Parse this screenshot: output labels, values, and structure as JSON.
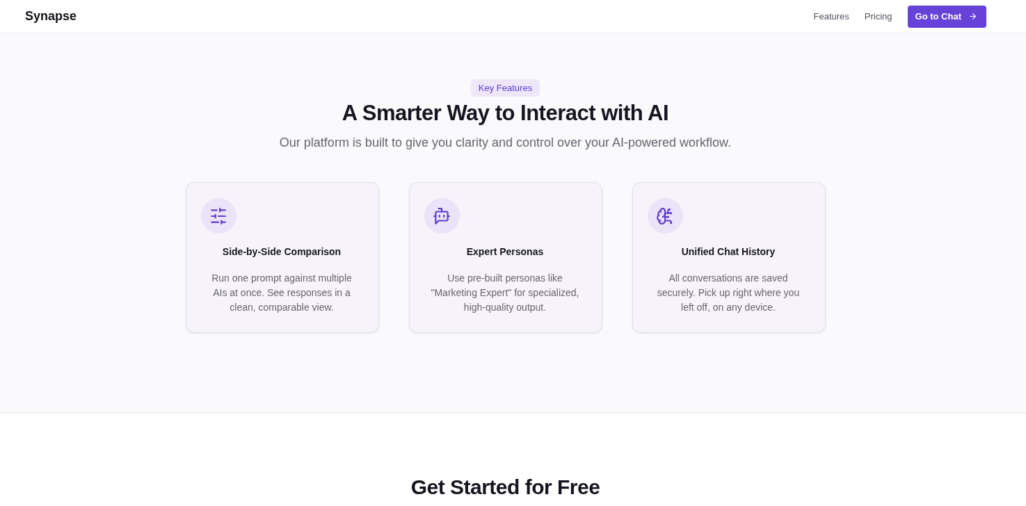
{
  "header": {
    "logo": "Synapse",
    "nav": [
      {
        "label": "Features"
      },
      {
        "label": "Pricing"
      }
    ],
    "cta": {
      "label": "Go to Chat"
    }
  },
  "features": {
    "badge": "Key Features",
    "title": "A Smarter Way to Interact with AI",
    "subtitle": "Our platform is built to give you clarity and control over your AI-powered workflow.",
    "cards": [
      {
        "title": "Side-by-Side Comparison",
        "description": "Run one prompt against multiple AIs at once. See responses in a clean, comparable view."
      },
      {
        "title": "Expert Personas",
        "description": "Use pre-built personas like \"Marketing Expert\" for specialized, high-quality output."
      },
      {
        "title": "Unified Chat History",
        "description": "All conversations are saved securely. Pick up right where you left off, on any device."
      }
    ]
  },
  "get_started": {
    "title": "Get Started for Free"
  }
}
